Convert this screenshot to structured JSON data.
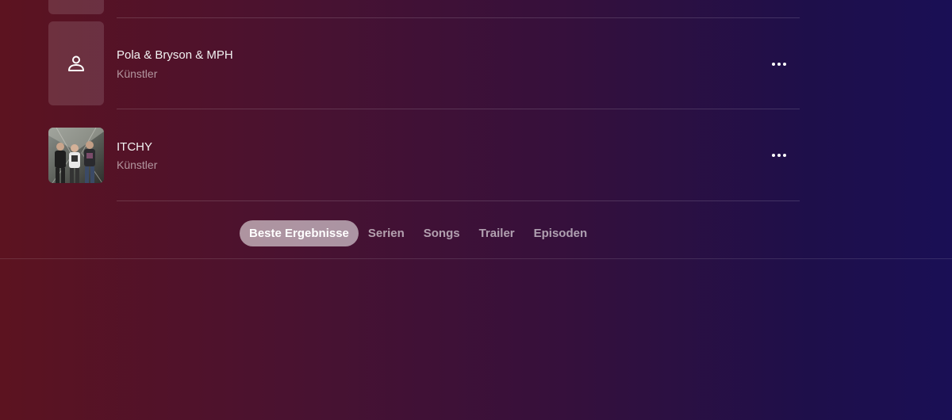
{
  "results": [
    {
      "title": "Pola & Bryson & MPH",
      "subtitle": "Künstler",
      "icon": "person-icon",
      "more_icon": "ellipsis-icon"
    },
    {
      "title": "ITCHY",
      "subtitle": "Künstler",
      "image": "band-photo",
      "more_icon": "ellipsis-icon"
    }
  ],
  "tabs": [
    {
      "label": "Beste Ergebnisse",
      "active": true
    },
    {
      "label": "Serien",
      "active": false
    },
    {
      "label": "Songs",
      "active": false
    },
    {
      "label": "Trailer",
      "active": false
    },
    {
      "label": "Episoden",
      "active": false
    }
  ]
}
